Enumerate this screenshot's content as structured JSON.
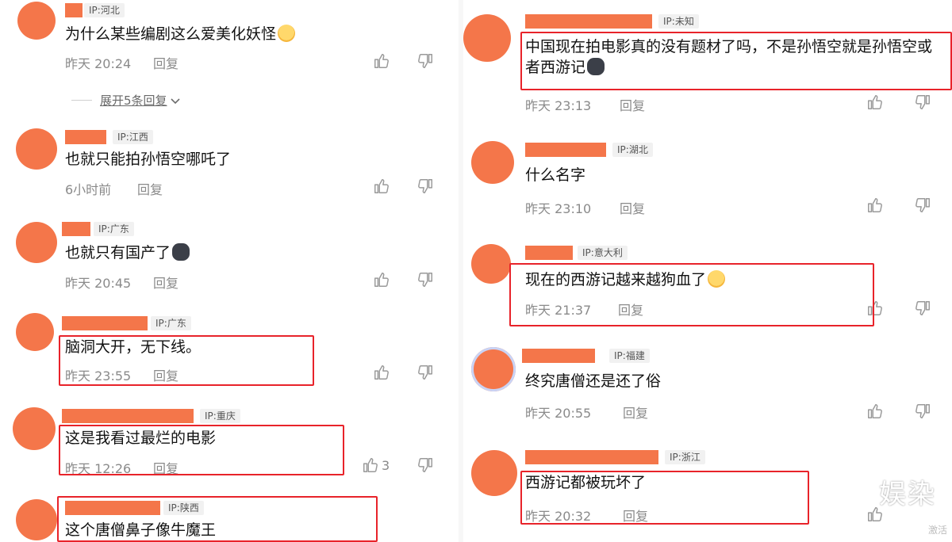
{
  "left": [
    {
      "ip": "IP:河北",
      "text": "为什么某些编剧这么爱美化妖怪",
      "emoji": "laugh-sweat",
      "time": "昨天 20:24",
      "reply": "回复",
      "likes": ""
    },
    {
      "ip": "IP:江西",
      "text": "也就只能拍孙悟空哪吒了",
      "time": "6小时前",
      "reply": "回复",
      "likes": ""
    },
    {
      "ip": "IP:广东",
      "text": "也就只有国产了",
      "emoji": "dog",
      "time": "昨天 20:45",
      "reply": "回复",
      "likes": ""
    },
    {
      "ip": "IP:广东",
      "text": "脑洞大开，无下线。",
      "time": "昨天 23:55",
      "reply": "回复",
      "likes": ""
    },
    {
      "ip": "IP:重庆",
      "text": "这是我看过最烂的电影",
      "time": "昨天 12:26",
      "reply": "回复",
      "likes": "3"
    },
    {
      "ip": "IP:陕西",
      "text": "这个唐僧鼻子像牛魔王"
    }
  ],
  "expand_label": "展开5条回复",
  "right": [
    {
      "ip": "IP:未知",
      "text": "中国现在拍电影真的没有题材了吗，不是孙悟空就是孙悟空或者西游记",
      "emoji": "dog",
      "time": "昨天 23:13",
      "reply": "回复"
    },
    {
      "ip": "IP:湖北",
      "text": "什么名字",
      "time": "昨天 23:10",
      "reply": "回复"
    },
    {
      "ip": "IP:意大利",
      "text": "现在的西游记越来越狗血了",
      "emoji": "laugh-sweat",
      "time": "昨天 21:37",
      "reply": "回复"
    },
    {
      "ip": "IP:福建",
      "text": "终究唐僧还是还了俗",
      "time": "昨天 20:55",
      "reply": "回复"
    },
    {
      "ip": "IP:浙江",
      "text": "西游记都被玩坏了",
      "time": "昨天 20:32",
      "reply": "回复"
    }
  ],
  "watermark": "娱染",
  "watermark_sub": "激活",
  "colors": {
    "avatar": "#f4764a",
    "highlight": "#e8232a",
    "meta": "#8a8a8a"
  }
}
